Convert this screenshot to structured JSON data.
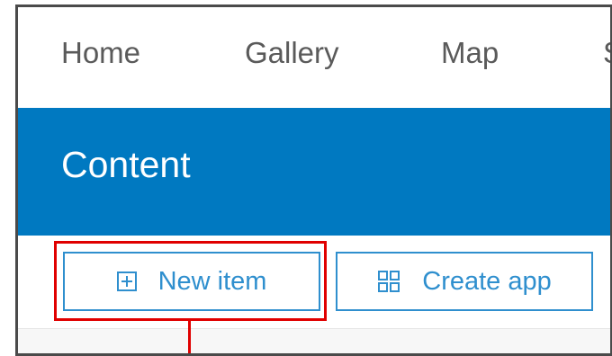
{
  "nav": {
    "items": [
      {
        "label": "Home"
      },
      {
        "label": "Gallery"
      },
      {
        "label": "Map"
      },
      {
        "label": "S"
      }
    ]
  },
  "banner": {
    "title": "Content"
  },
  "toolbar": {
    "new_item_label": "New item",
    "new_item_icon": "plus-square-icon",
    "create_app_label": "Create app",
    "create_app_icon": "grid-apps-icon"
  },
  "colors": {
    "brand_blue": "#0079c1",
    "button_blue": "#2f8fce",
    "highlight_red": "#e00000",
    "nav_text": "#5a5a5a"
  }
}
